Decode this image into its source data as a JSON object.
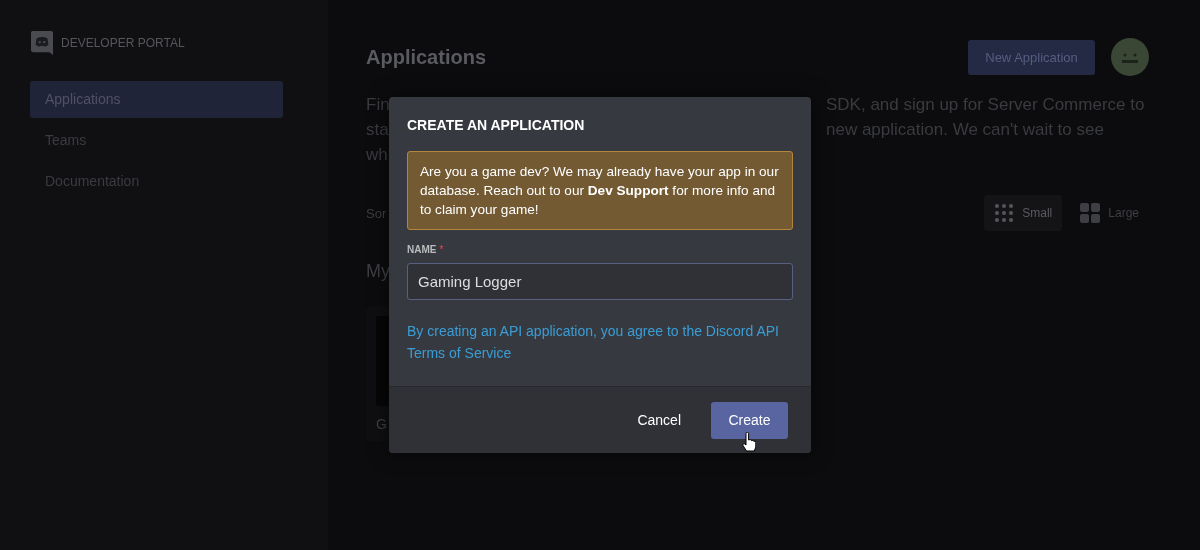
{
  "sidebar": {
    "brand": "DEVELOPER PORTAL",
    "items": [
      {
        "label": "Applications",
        "selected": true
      },
      {
        "label": "Teams",
        "selected": false
      },
      {
        "label": "Documentation",
        "selected": false
      }
    ]
  },
  "main": {
    "title": "Applications",
    "new_button": "New Application",
    "intro_lines": [
      {
        "left": "Fin",
        "right": "SDK, and sign up for Server Commerce to"
      },
      {
        "left": "sta",
        "right": "new application. We can't wait to see"
      },
      {
        "left": "wh"
      }
    ],
    "sort_label": "Sor",
    "views": [
      {
        "label": "Small",
        "selected": true
      },
      {
        "label": "Large",
        "selected": false
      }
    ],
    "section_title": "My",
    "card_label": "G"
  },
  "modal": {
    "title": "CREATE AN APPLICATION",
    "notice": "Are you a game dev? We may already have your app in our database. Reach out to our **Dev Support** for more info and to claim your game!",
    "field_label": "NAME",
    "required_mark": "*",
    "value": "Gaming Logger",
    "terms_link": "By creating an API application, you agree to the Discord API Terms of Service",
    "buttons": [
      {
        "label": "Cancel",
        "kind": "secondary"
      },
      {
        "label": "Create",
        "kind": "primary"
      }
    ]
  }
}
